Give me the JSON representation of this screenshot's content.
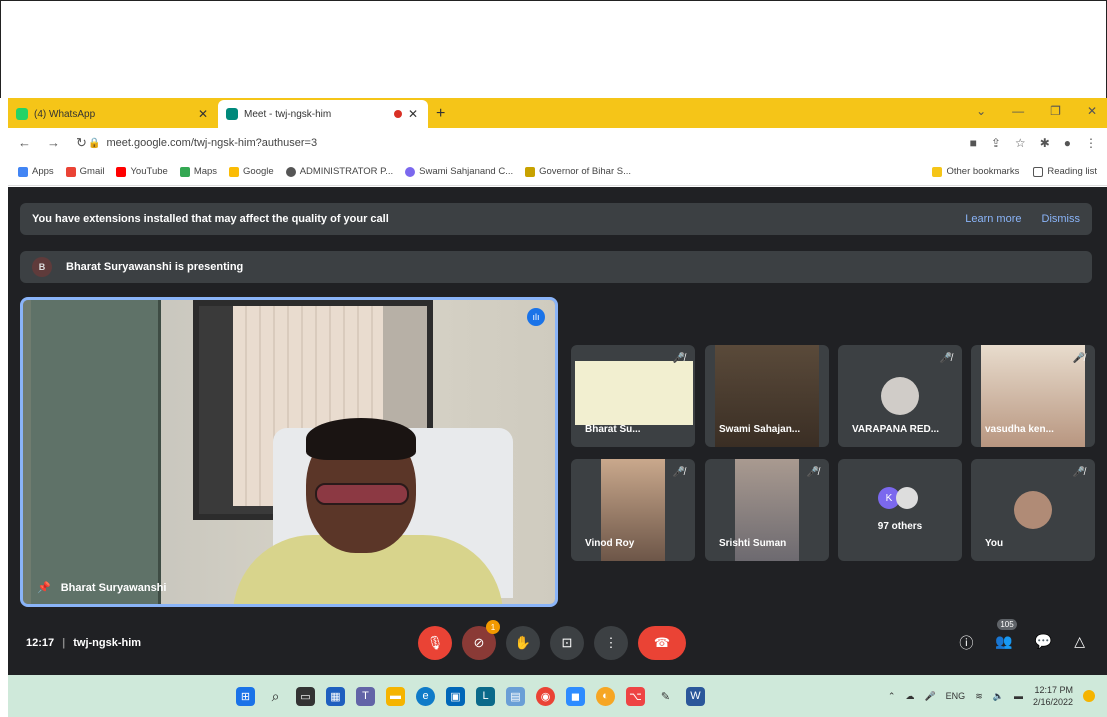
{
  "browser": {
    "tabs": [
      {
        "label": "(4) WhatsApp",
        "active": false,
        "color": "#25d366"
      },
      {
        "label": "Meet - twj-ngsk-him",
        "active": true,
        "color": "#00897b"
      }
    ],
    "url": "meet.google.com/twj-ngsk-him?authuser=3",
    "bookmarks": [
      {
        "label": "Apps",
        "color": "#4285f4"
      },
      {
        "label": "Gmail",
        "color": "#ea4335"
      },
      {
        "label": "YouTube",
        "color": "#ff0000"
      },
      {
        "label": "Maps",
        "color": "#34a853"
      },
      {
        "label": "Google",
        "color": "#fbbc05"
      },
      {
        "label": "ADMINISTRATOR P...",
        "color": "#555555"
      },
      {
        "label": "Swami Sahjanand C...",
        "color": "#7b68ee"
      },
      {
        "label": "Governor of Bihar S...",
        "color": "#c8a200"
      }
    ],
    "other_bookmarks": "Other bookmarks",
    "reading_list": "Reading list"
  },
  "meet": {
    "banner_text": "You have extensions installed that may affect the quality of your call",
    "learn_more": "Learn more",
    "dismiss": "Dismiss",
    "presenter_initial": "B",
    "presenting_text": "Bharat Suryawanshi is presenting",
    "main_name": "Bharat Suryawanshi",
    "tiles": {
      "t1": "Bharat Su...",
      "t2": "Swami Sahajan...",
      "t3": "VARAPANA RED...",
      "t4": "vasudha ken...",
      "t5": "Vinod Roy",
      "t6": "Srishti Suman",
      "t7": "97 others",
      "t7_initial": "K",
      "t8": "You"
    },
    "time": "12:17",
    "separator": "|",
    "meeting_code": "twj-ngsk-him",
    "camera_badge": "1",
    "people_count": "105"
  },
  "taskbar": {
    "lang": "ENG",
    "time": "12:17 PM",
    "date": "2/16/2022"
  }
}
